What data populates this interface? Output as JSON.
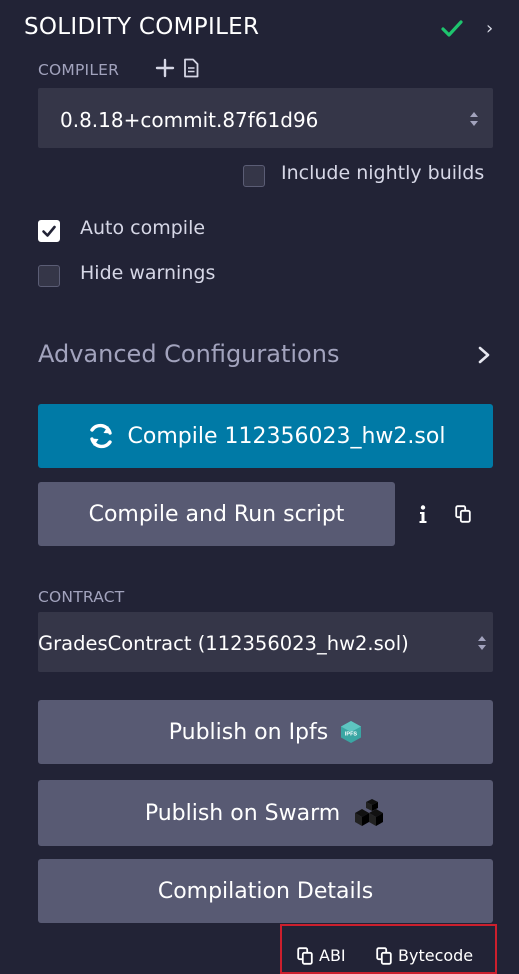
{
  "header": {
    "title": "SOLIDITY COMPILER",
    "status_color": "#1ec46e"
  },
  "compiler": {
    "label": "COMPILER",
    "version": "0.8.18+commit.87f61d96",
    "include_nightly_label": "Include nightly builds",
    "include_nightly_checked": false,
    "auto_compile_label": "Auto compile",
    "auto_compile_checked": true,
    "hide_warnings_label": "Hide warnings",
    "hide_warnings_checked": false
  },
  "advanced": {
    "label": "Advanced Configurations"
  },
  "actions": {
    "compile_label": "Compile 112356023_hw2.sol",
    "compile_run_label": "Compile and Run script",
    "info_icon": "info-icon",
    "copy_icon": "copy-icon"
  },
  "contract": {
    "label": "CONTRACT",
    "selected": "GradesContract (112356023_hw2.sol)"
  },
  "publish": {
    "ipfs_label": "Publish on Ipfs",
    "ipfs_badge": "IPFS",
    "swarm_label": "Publish on Swarm",
    "details_label": "Compilation Details"
  },
  "footer": {
    "abi_label": "ABI",
    "bytecode_label": "Bytecode"
  },
  "colors": {
    "primary": "#007aa6",
    "panel": "#222336",
    "button": "#585a73",
    "highlight_box": "#cc1f2d"
  }
}
